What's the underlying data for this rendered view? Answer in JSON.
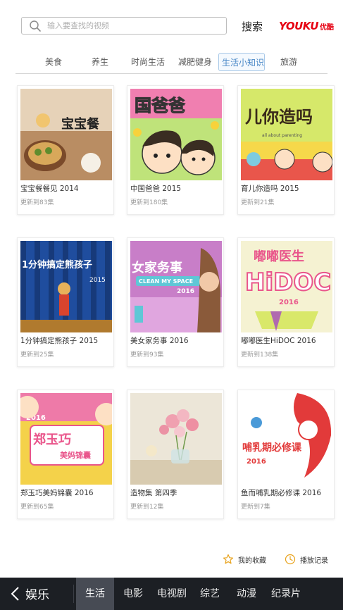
{
  "search": {
    "placeholder": "输入要查找的视频",
    "button_label": "搜索"
  },
  "logo": {
    "brand": "YOUKU",
    "brand_cn": "优酷"
  },
  "tabs": [
    {
      "label": "美食",
      "active": false
    },
    {
      "label": "养生",
      "active": false
    },
    {
      "label": "时尚生活",
      "active": false
    },
    {
      "label": "减肥健身",
      "active": false
    },
    {
      "label": "生活小知识",
      "active": true
    },
    {
      "label": "旅游",
      "active": false
    }
  ],
  "cards": [
    {
      "title": "宝宝餐餐见 2014",
      "updated": "更新到83集",
      "thumb_text": "宝宝餐"
    },
    {
      "title": "中国爸爸 2015",
      "updated": "更新到180集",
      "thumb_text": "国爸爸"
    },
    {
      "title": "育儿你造吗 2015",
      "updated": "更新到21集",
      "thumb_text": "儿你造吗",
      "thumb_sub": "all about parenting"
    },
    {
      "title": "1分钟搞定熊孩子 2015",
      "updated": "更新到25集",
      "thumb_text": "1分钟搞定熊孩子",
      "thumb_sub": "2015"
    },
    {
      "title": "美女家务事 2016",
      "updated": "更新到93集",
      "thumb_text": "女家务事",
      "thumb_sub": "CLEAN MY SPACE",
      "thumb_year": "2016"
    },
    {
      "title": "嘟嘟医生HiDOC 2016",
      "updated": "更新到138集",
      "thumb_text": "嘟嘟医生",
      "thumb_sub": "HiDOC",
      "thumb_year": "2016"
    },
    {
      "title": "郑玉巧美妈锦囊 2016",
      "updated": "更新到65集",
      "thumb_text": "郑玉巧",
      "thumb_sub": "美妈锦囊",
      "thumb_year": "2016"
    },
    {
      "title": "造物集 第四季",
      "updated": "更新到12集"
    },
    {
      "title": "鱼而哺乳期必修课 2016",
      "updated": "更新到7集",
      "thumb_text": "哺乳期必修课",
      "thumb_year": "2016"
    }
  ],
  "footer": {
    "favorites_label": "我的收藏",
    "history_label": "播放记录"
  },
  "bottom_nav": {
    "back_label": "娱乐",
    "items": [
      {
        "label": "生活",
        "active": true
      },
      {
        "label": "电影",
        "active": false
      },
      {
        "label": "电视剧",
        "active": false
      },
      {
        "label": "综艺",
        "active": false
      },
      {
        "label": "动漫",
        "active": false
      },
      {
        "label": "纪录片",
        "active": false
      }
    ]
  },
  "colors": {
    "accent": "#4a88c7",
    "brand": "#e60012",
    "nav_bg": "#1c1f24"
  }
}
